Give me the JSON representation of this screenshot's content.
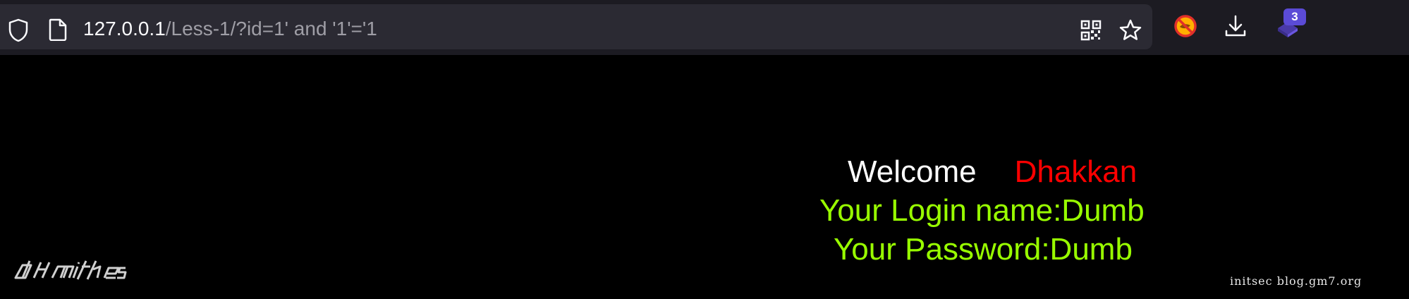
{
  "browser": {
    "url_host": "127.0.0.1",
    "url_path": "/Less-1/?id=1' and '1'='1",
    "extensions_badge_count": "3",
    "icons": {
      "shield": "shield-icon",
      "page": "page-icon",
      "qr": "qr-code-icon",
      "bookmark": "star-icon",
      "blocked_extension": "blocked-extension-icon",
      "downloads": "download-icon",
      "extensions": "extensions-icon"
    }
  },
  "page": {
    "welcome_word": "Welcome",
    "welcome_name": "Dhakkan",
    "login_line": "Your Login name:Dumb",
    "password_line": "Your Password:Dumb",
    "footer": "initsec blog.gm7.org",
    "logo": "dhakkan-logo",
    "colors": {
      "background": "#000000",
      "welcome": "#ffffff",
      "name": "#ff0000",
      "credentials": "#99ff00"
    }
  }
}
